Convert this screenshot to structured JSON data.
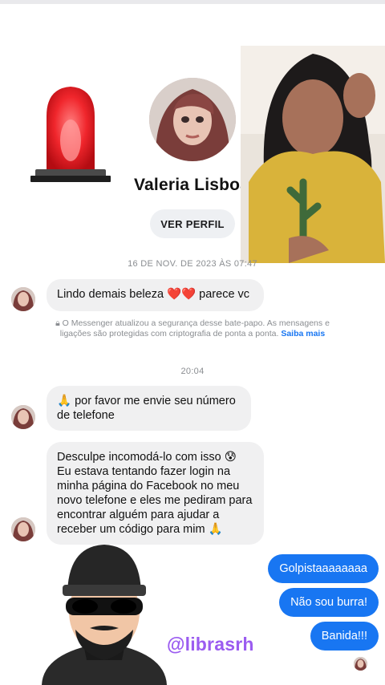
{
  "profile": {
    "name": "Valeria Lisboa",
    "view_profile_label": "VER PERFIL"
  },
  "thread": {
    "date_stamp": "16 DE NOV. DE 2023 ÀS 07:47",
    "time_stamp": "20:04",
    "security_notice": "O Messenger atualizou a segurança desse bate-papo. As mensagens e ligações são protegidas com criptografia de ponta a ponta.",
    "security_link": "Saiba mais",
    "incoming": [
      {
        "text": "Lindo demais beleza ❤️❤️ parece vc"
      },
      {
        "text": "🙏 por favor me envie seu número de telefone"
      },
      {
        "text": "Desculpe incomodá-lo com isso 😰 Eu estava tentando fazer login na minha página do Facebook no meu novo telefone e eles me pediram para encontrar alguém para ajudar a receber um código para mim 🙏"
      }
    ],
    "outgoing": [
      {
        "text": "Golpistaaaaaaaa"
      },
      {
        "text": "Não sou burra!"
      },
      {
        "text": "Banida!!!"
      }
    ]
  },
  "watermark": {
    "handle": "@librasrh"
  },
  "overlay_photo_caption": "",
  "icons": [
    "siren-icon",
    "lock-icon",
    "burglar-icon"
  ],
  "colors": {
    "accent_blue": "#1876f2",
    "incoming_bubble": "#f0f0f1",
    "handle_purple": "#9b5cf0",
    "siren_red": "#e8202a"
  }
}
